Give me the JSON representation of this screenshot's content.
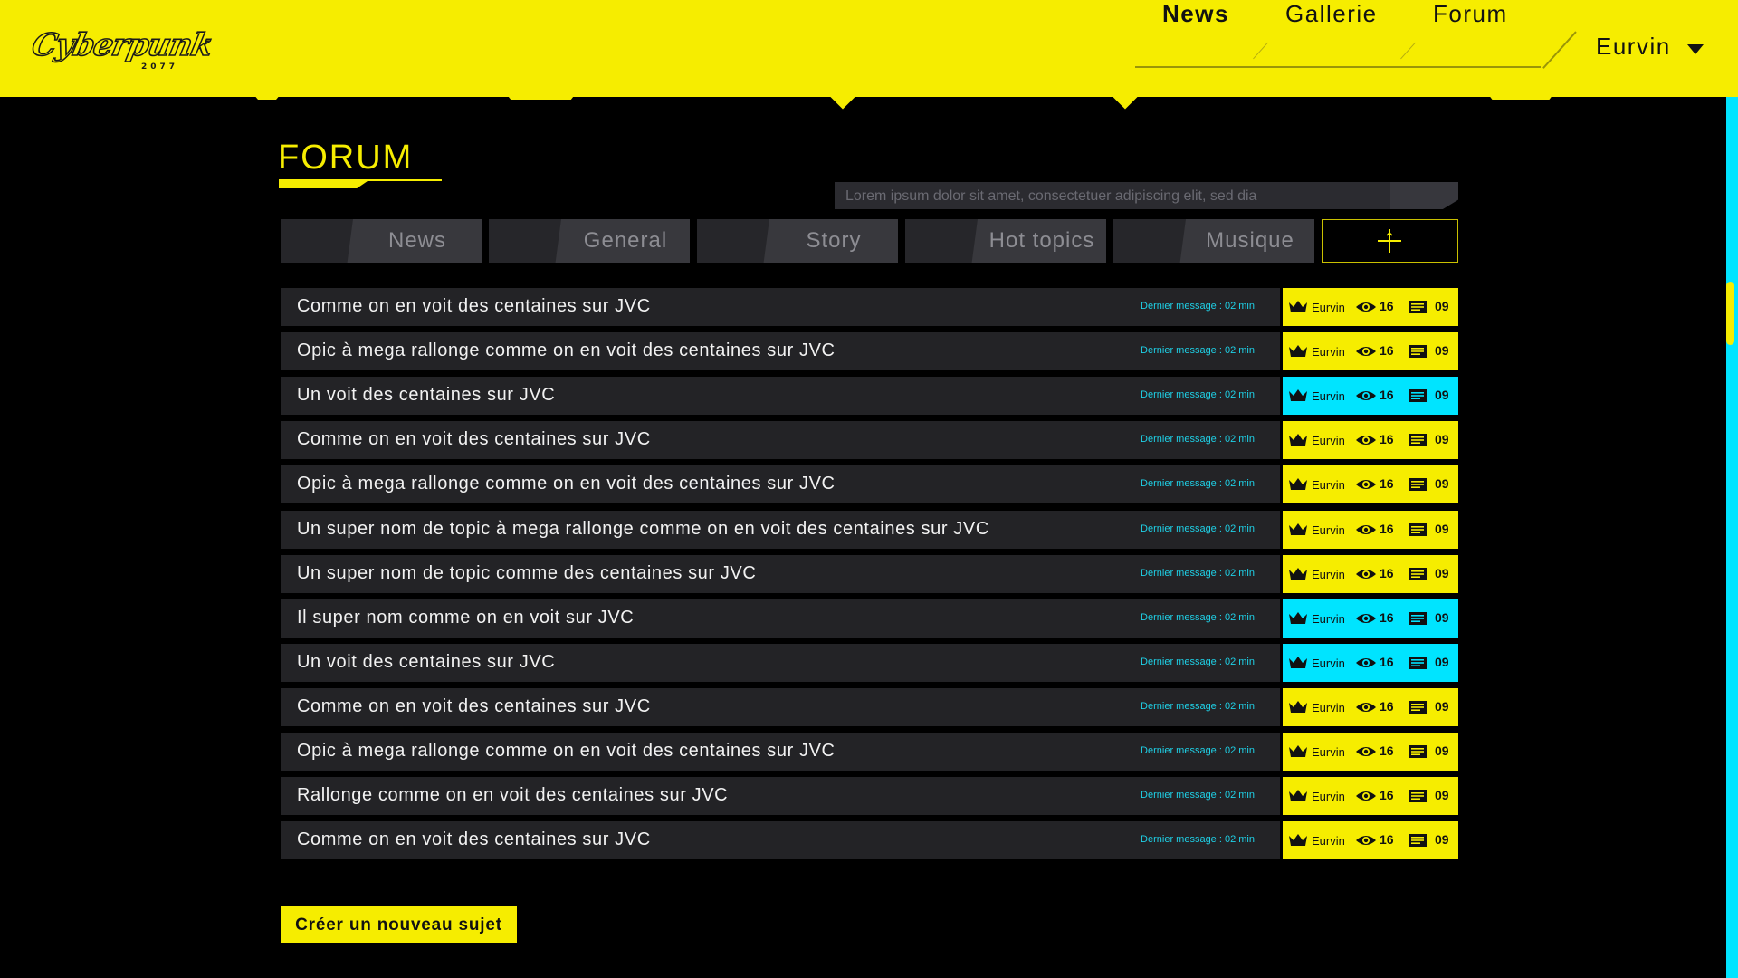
{
  "header": {
    "logo_text": "Cyberpunk",
    "logo_year": "2077",
    "nav": [
      {
        "label": "News",
        "active": true
      },
      {
        "label": "Gallerie",
        "active": false
      },
      {
        "label": "Forum",
        "active": false
      }
    ],
    "user": "Eurvin"
  },
  "page": {
    "title": "FORUM",
    "search_placeholder": "Lorem ipsum dolor sit amet, consectetuer adipiscing elit, sed dia"
  },
  "tabs": [
    "News",
    "General",
    "Story",
    "Hot topics",
    "Musique"
  ],
  "topics": [
    {
      "title": "Comme on en voit des centaines sur JVC",
      "last": "Dernier message : 02 min",
      "author": "Eurvin",
      "views": "16",
      "replies": "09",
      "highlight": false
    },
    {
      "title": "Opic à mega rallonge comme on en voit des centaines sur JVC",
      "last": "Dernier message : 02 min",
      "author": "Eurvin",
      "views": "16",
      "replies": "09",
      "highlight": false
    },
    {
      "title": "Un voit des centaines sur JVC",
      "last": "Dernier message : 02 min",
      "author": "Eurvin",
      "views": "16",
      "replies": "09",
      "highlight": true
    },
    {
      "title": "Comme on en voit des centaines sur JVC",
      "last": "Dernier message : 02 min",
      "author": "Eurvin",
      "views": "16",
      "replies": "09",
      "highlight": false
    },
    {
      "title": "Opic à mega rallonge comme on en voit des centaines sur JVC",
      "last": "Dernier message : 02 min",
      "author": "Eurvin",
      "views": "16",
      "replies": "09",
      "highlight": false
    },
    {
      "title": "Un super nom de topic à mega rallonge comme on en voit des centaines sur JVC",
      "last": "Dernier message : 02 min",
      "author": "Eurvin",
      "views": "16",
      "replies": "09",
      "highlight": false
    },
    {
      "title": "Un super nom de topic comme des centaines sur JVC",
      "last": "Dernier message : 02 min",
      "author": "Eurvin",
      "views": "16",
      "replies": "09",
      "highlight": false
    },
    {
      "title": "Il super nom  comme on en voit sur JVC",
      "last": "Dernier message : 02 min",
      "author": "Eurvin",
      "views": "16",
      "replies": "09",
      "highlight": true
    },
    {
      "title": "Un voit des centaines sur JVC",
      "last": "Dernier message : 02 min",
      "author": "Eurvin",
      "views": "16",
      "replies": "09",
      "highlight": true
    },
    {
      "title": "Comme on en voit des centaines sur JVC",
      "last": "Dernier message : 02 min",
      "author": "Eurvin",
      "views": "16",
      "replies": "09",
      "highlight": false
    },
    {
      "title": "Opic à mega rallonge comme on en voit des centaines sur JVC",
      "last": "Dernier message : 02 min",
      "author": "Eurvin",
      "views": "16",
      "replies": "09",
      "highlight": false
    },
    {
      "title": "Rallonge comme on en voit des centaines sur JVC",
      "last": "Dernier message : 02 min",
      "author": "Eurvin",
      "views": "16",
      "replies": "09",
      "highlight": false
    },
    {
      "title": "Comme on en voit des centaines sur JVC",
      "last": "Dernier message : 02 min",
      "author": "Eurvin",
      "views": "16",
      "replies": "09",
      "highlight": false
    }
  ],
  "create_button": "Créer un nouveau sujet",
  "colors": {
    "yellow": "#f6ed00",
    "cyan": "#00e4ff",
    "row_bg": "#232326",
    "text_cyan": "#1fd0e6"
  },
  "icons": {
    "author": "crown-icon",
    "views": "eye-icon",
    "replies": "message-icon",
    "add_tab": "plus-icon",
    "user_menu": "caret-down-icon"
  }
}
